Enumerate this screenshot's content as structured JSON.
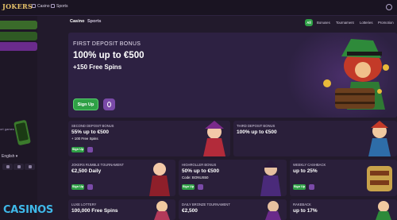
{
  "topbar": {
    "logo": "JOKERS",
    "nav": [
      "Casino",
      "Sports"
    ]
  },
  "sidebar": {
    "side_text": "ort games",
    "language": "English",
    "language_chevron": "chevron-down-icon"
  },
  "watermark": "CASINOS",
  "main_tabs": [
    "Casino",
    "Sports"
  ],
  "filters": [
    "All",
    "Bonuses",
    "Tournament",
    "Lotteries",
    "Promotion"
  ],
  "hero": {
    "label": "FIRST DEPOSIT BONUS",
    "amount": "100% up to €500",
    "spins": "+150 Free Spins",
    "signup": "Sign Up"
  },
  "cards": [
    {
      "label": "SECOND DEPOSIT BONUS",
      "amount": "55% up to €500",
      "sub": "+ 100 Free Spins",
      "signup": "Sign Up"
    },
    {
      "label": "THIRD DEPOSIT BONUS",
      "amount": "100% up to €500",
      "sub": "",
      "signup": ""
    },
    {
      "label": "JOKERS RUMBLE TOURNAMENT",
      "amount": "€2,500 Daily",
      "sub": "",
      "signup": "Sign Up"
    },
    {
      "label": "HIGHROLLER BONUS",
      "amount": "50% up to €500",
      "sub": "Code: BONUS50",
      "signup": "Sign Up"
    },
    {
      "label": "WEEKLY CASHBACK",
      "amount": "up to 25%",
      "sub": "",
      "signup": "Sign Up"
    },
    {
      "label": "LUXE LOTTERY",
      "amount": "100,000 Free Spins",
      "sub": "",
      "signup": ""
    },
    {
      "label": "DAILY BRONZE TOURNAMENT",
      "amount": "€2,500",
      "sub": "",
      "signup": ""
    },
    {
      "label": "RAKEBACK",
      "amount": "up to 17%",
      "sub": "",
      "signup": ""
    }
  ],
  "colors": {
    "accent_green": "#2fa046",
    "accent_purple": "#7a4aa8",
    "background": "#221a2c"
  }
}
